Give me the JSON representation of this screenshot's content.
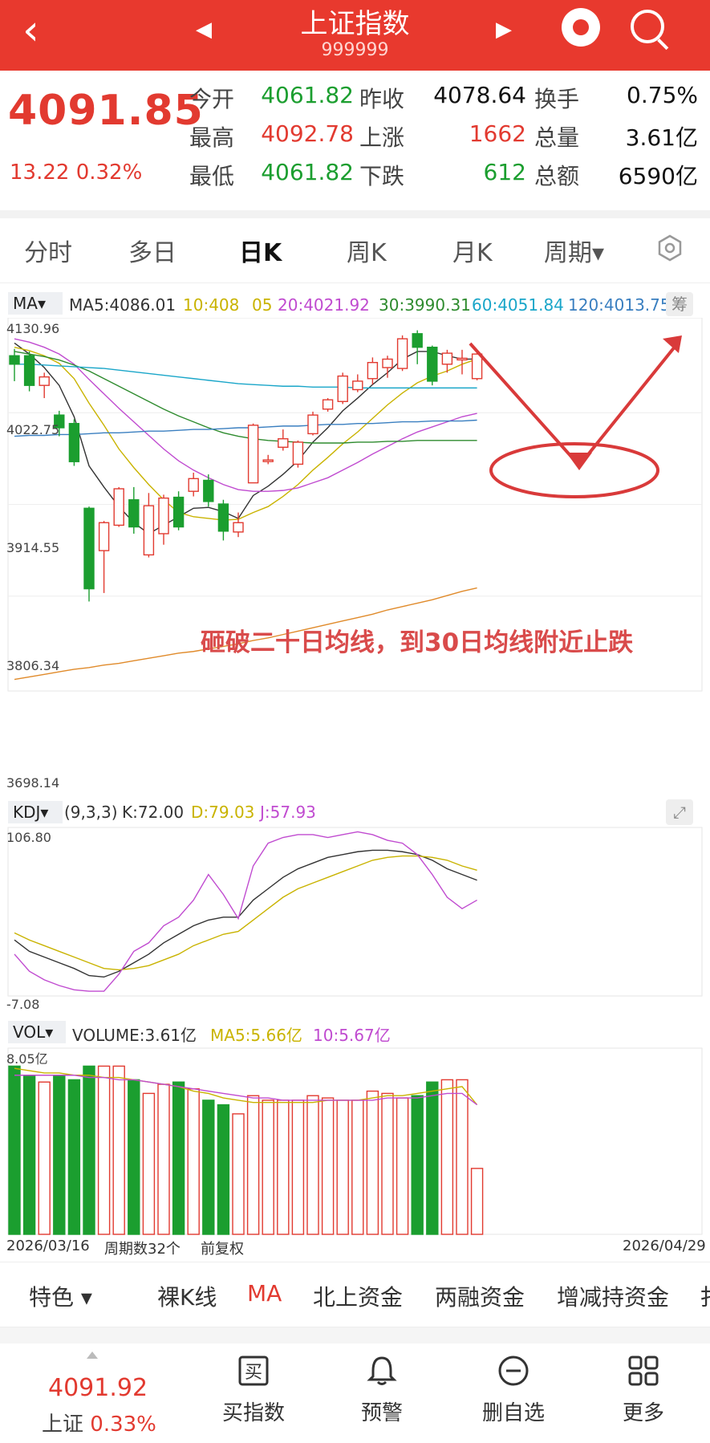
{
  "header": {
    "back_icon": "chevron-left-icon",
    "title": "上证指数",
    "code": "999999",
    "prev_icon": "triangle-left-icon",
    "next_icon": "triangle-right-icon",
    "mascot_icon": "mascot-icon",
    "search_icon": "search-icon"
  },
  "quote": {
    "price": "4091.85",
    "change": "13.22  0.32%",
    "rows": [
      [
        {
          "l": "今开"
        },
        {
          "v": "4061.82",
          "c": "g"
        },
        {
          "l": "昨收"
        },
        {
          "v": "4078.64",
          "c": "k"
        },
        {
          "l": "换手"
        },
        {
          "v": "0.75%",
          "c": "k"
        }
      ],
      [
        {
          "l": "最高"
        },
        {
          "v": "4092.78",
          "c": "r"
        },
        {
          "l": "上涨"
        },
        {
          "v": "1662",
          "c": "r"
        },
        {
          "l": "总量"
        },
        {
          "v": "3.61亿",
          "c": "k"
        }
      ],
      [
        {
          "l": "最低"
        },
        {
          "v": "4061.82",
          "c": "g"
        },
        {
          "l": "下跌"
        },
        {
          "v": "612",
          "c": "g"
        },
        {
          "l": "总额"
        },
        {
          "v": "6590亿",
          "c": "k"
        }
      ]
    ]
  },
  "tabs": [
    "分时",
    "多日",
    "日K",
    "周K",
    "月K",
    "周期▾"
  ],
  "active_tab": "日K",
  "ma": {
    "tag": "MA▾",
    "ma5": "MA5:4086.01",
    "ma10": "10:408",
    "ma_hidden": "05",
    "ma20": "20:4021.92",
    "ma30": "30:3990.31",
    "ma60": "60:4051.84",
    "ma120": "120:4013.75",
    "chou": "筹"
  },
  "price_axis": [
    "4130.96",
    "4022.75",
    "3914.55",
    "3806.34",
    "3698.14"
  ],
  "annotation": "砸破二十日均线，到30日均线附近止跌",
  "kdj": {
    "tag": "KDJ▾",
    "params": "(9,3,3)",
    "k": "K:72.00",
    "d": "D:79.03",
    "j": "J:57.93",
    "axis_top": "106.80",
    "axis_bottom": "-7.08"
  },
  "vol": {
    "tag": "VOL▾",
    "volume": "VOLUME:3.61亿",
    "ma5": "MA5:5.66亿",
    "ma10": "10:5.67亿",
    "axis_top": "8.05亿"
  },
  "dates": {
    "start": "2026/03/16",
    "count": "周期数32个",
    "fq": "前复权",
    "end": "2026/04/29"
  },
  "features": [
    "特色 ▾",
    "裸K线",
    "MA",
    "北上资金",
    "两融资金",
    "增减持资金",
    "扌"
  ],
  "bottom": {
    "price": "4091.92",
    "name": "上证",
    "pct": "0.33%",
    "buttons": [
      {
        "label": "买指数",
        "icon": "buy-icon"
      },
      {
        "label": "预警",
        "icon": "bell-icon"
      },
      {
        "label": "删自选",
        "icon": "minus-circle-icon"
      },
      {
        "label": "更多",
        "icon": "grid-icon"
      }
    ]
  },
  "colors": {
    "brand_red": "#e8392e",
    "up": "#e23a30",
    "down": "#1b9e2f",
    "ma5": "#333333",
    "ma10": "#c9b300",
    "ma20": "#c04bd0",
    "ma30": "#2e8b2e",
    "ma60": "#1aa6c9",
    "ma120": "#3a7fc0",
    "ma250": "#e08a2a"
  },
  "chart_data": {
    "type": "candlestick",
    "ylim": [
      3698.14,
      4130.96
    ],
    "candles": [
      {
        "o": 4090,
        "c": 4080,
        "h": 4098,
        "l": 4060
      },
      {
        "o": 4090,
        "c": 4055,
        "h": 4095,
        "l": 4048
      },
      {
        "o": 4055,
        "c": 4065,
        "h": 4070,
        "l": 4040
      },
      {
        "o": 4020,
        "c": 4005,
        "h": 4025,
        "l": 3995
      },
      {
        "o": 4010,
        "c": 3965,
        "h": 4015,
        "l": 3960
      },
      {
        "o": 3910,
        "c": 3815,
        "h": 3912,
        "l": 3800
      },
      {
        "o": 3860,
        "c": 3893,
        "h": 3895,
        "l": 3810
      },
      {
        "o": 3890,
        "c": 3933,
        "h": 3935,
        "l": 3888
      },
      {
        "o": 3920,
        "c": 3888,
        "h": 3935,
        "l": 3880
      },
      {
        "o": 3855,
        "c": 3913,
        "h": 3928,
        "l": 3852
      },
      {
        "o": 3880,
        "c": 3922,
        "h": 3926,
        "l": 3867
      },
      {
        "o": 3923,
        "c": 3888,
        "h": 3930,
        "l": 3884
      },
      {
        "o": 3930,
        "c": 3945,
        "h": 3952,
        "l": 3924
      },
      {
        "o": 3943,
        "c": 3918,
        "h": 3950,
        "l": 3912
      },
      {
        "o": 3915,
        "c": 3883,
        "h": 3920,
        "l": 3872
      },
      {
        "o": 3882,
        "c": 3893,
        "h": 3905,
        "l": 3876
      },
      {
        "o": 3940,
        "c": 4008,
        "h": 4010,
        "l": 3940
      },
      {
        "o": 3967,
        "c": 3967,
        "h": 3973,
        "l": 3962
      },
      {
        "o": 3982,
        "c": 3992,
        "h": 4003,
        "l": 3978
      },
      {
        "o": 3962,
        "c": 3988,
        "h": 3990,
        "l": 3958
      },
      {
        "o": 3998,
        "c": 4020,
        "h": 4024,
        "l": 3996
      },
      {
        "o": 4027,
        "c": 4038,
        "h": 4040,
        "l": 4024
      },
      {
        "o": 4036,
        "c": 4066,
        "h": 4070,
        "l": 4033
      },
      {
        "o": 4050,
        "c": 4060,
        "h": 4068,
        "l": 4047
      },
      {
        "o": 4063,
        "c": 4082,
        "h": 4088,
        "l": 4056
      },
      {
        "o": 4076,
        "c": 4086,
        "h": 4090,
        "l": 4064
      },
      {
        "o": 4075,
        "c": 4110,
        "h": 4114,
        "l": 4072
      },
      {
        "o": 4116,
        "c": 4100,
        "h": 4120,
        "l": 4080
      },
      {
        "o": 4100,
        "c": 4060,
        "h": 4102,
        "l": 4055
      },
      {
        "o": 4080,
        "c": 4093,
        "h": 4097,
        "l": 4070
      },
      {
        "o": 4086,
        "c": 4087,
        "h": 4097,
        "l": 4068
      },
      {
        "o": 4063,
        "c": 4092,
        "h": 4093,
        "l": 4061
      }
    ],
    "ma_series": [
      {
        "name": "MA5",
        "values": [
          4105,
          4092,
          4076,
          4055,
          4018,
          3960,
          3935,
          3912,
          3893,
          3880,
          3890,
          3900,
          3910,
          3911,
          3906,
          3898,
          3925,
          3936,
          3950,
          3966,
          3988,
          4005,
          4025,
          4040,
          4056,
          4070,
          4086,
          4095,
          4095,
          4090,
          4086,
          4086
        ]
      },
      {
        "name": "MA10",
        "values": [
          4100,
          4096,
          4090,
          4081,
          4063,
          4034,
          4008,
          3980,
          3958,
          3938,
          3920,
          3905,
          3900,
          3898,
          3896,
          3897,
          3905,
          3912,
          3924,
          3938,
          3955,
          3970,
          3986,
          4000,
          4016,
          4032,
          4046,
          4058,
          4066,
          4072,
          4080,
          4086
        ]
      },
      {
        "name": "MA20",
        "values": [
          4110,
          4106,
          4100,
          4092,
          4080,
          4062,
          4045,
          4028,
          4012,
          3996,
          3980,
          3966,
          3955,
          3946,
          3938,
          3932,
          3930,
          3930,
          3931,
          3934,
          3940,
          3946,
          3955,
          3964,
          3974,
          3983,
          3992,
          4000,
          4006,
          4012,
          4018,
          4022
        ]
      },
      {
        "name": "MA30",
        "values": [
          4095,
          4092,
          4089,
          4085,
          4079,
          4072,
          4063,
          4054,
          4045,
          4036,
          4027,
          4019,
          4012,
          4005,
          3999,
          3995,
          3992,
          3990,
          3989,
          3988,
          3987,
          3987,
          3987,
          3988,
          3988,
          3989,
          3989,
          3990,
          3990,
          3990,
          3990,
          3990
        ]
      },
      {
        "name": "MA60",
        "values": [
          4080,
          4080,
          4079,
          4078,
          4077,
          4076,
          4075,
          4073,
          4071,
          4069,
          4067,
          4065,
          4063,
          4061,
          4059,
          4057,
          4056,
          4055,
          4054,
          4054,
          4053,
          4053,
          4053,
          4052,
          4052,
          4052,
          4052,
          4052,
          4052,
          4052,
          4052,
          4052
        ]
      },
      {
        "name": "MA120",
        "values": [
          3995,
          3996,
          3996,
          3997,
          3997,
          3998,
          3999,
          3999,
          4000,
          4001,
          4001,
          4002,
          4003,
          4003,
          4004,
          4005,
          4005,
          4006,
          4007,
          4007,
          4008,
          4009,
          4009,
          4010,
          4010,
          4011,
          4012,
          4012,
          4013,
          4013,
          4013,
          4014
        ]
      },
      {
        "name": "MA250",
        "values": [
          3708,
          3711,
          3714,
          3717,
          3720,
          3722,
          3725,
          3727,
          3730,
          3733,
          3736,
          3739,
          3741,
          3744,
          3747,
          3750,
          3754,
          3757,
          3761,
          3765,
          3769,
          3773,
          3777,
          3781,
          3785,
          3790,
          3794,
          3798,
          3802,
          3807,
          3812,
          3816
        ]
      }
    ],
    "kdj": {
      "ylim": [
        -7.08,
        106.8
      ],
      "K": [
        30,
        22,
        18,
        14,
        10,
        5,
        4,
        8,
        14,
        20,
        28,
        34,
        40,
        44,
        46,
        46,
        58,
        66,
        74,
        80,
        84,
        88,
        90,
        92,
        93,
        93,
        92,
        90,
        86,
        80,
        76,
        72
      ],
      "D": [
        35,
        30,
        26,
        22,
        18,
        14,
        10,
        9,
        10,
        12,
        16,
        20,
        26,
        30,
        34,
        36,
        44,
        52,
        60,
        66,
        70,
        74,
        78,
        82,
        86,
        88,
        89,
        89,
        88,
        86,
        82,
        79
      ],
      "J": [
        20,
        8,
        2,
        -2,
        -5,
        -6,
        -6,
        6,
        22,
        28,
        40,
        46,
        58,
        76,
        62,
        45,
        82,
        98,
        102,
        104,
        104,
        102,
        104,
        106,
        104,
        100,
        98,
        90,
        76,
        60,
        52,
        58
      ]
    },
    "volume": {
      "ylim": [
        0,
        8.05
      ],
      "values": [
        7.4,
        7.0,
        6.7,
        7.0,
        6.8,
        7.4,
        7.4,
        7.4,
        6.8,
        6.2,
        6.6,
        6.7,
        6.4,
        5.9,
        5.7,
        5.3,
        6.1,
        5.9,
        5.9,
        5.9,
        6.1,
        6.0,
        5.9,
        5.9,
        6.3,
        6.2,
        6.0,
        6.1,
        6.7,
        6.8,
        6.8,
        2.9
      ],
      "ma5": [
        7.3,
        7.2,
        7.1,
        7.1,
        7.0,
        7.0,
        6.9,
        6.9,
        6.8,
        6.7,
        6.6,
        6.5,
        6.3,
        6.2,
        6.0,
        5.9,
        5.8,
        5.8,
        5.8,
        5.8,
        5.8,
        5.9,
        5.9,
        5.9,
        6.0,
        6.1,
        6.1,
        6.2,
        6.3,
        6.4,
        6.5,
        5.7
      ],
      "ma10": [
        7.0,
        7.0,
        7.0,
        7.0,
        7.0,
        6.9,
        6.9,
        6.8,
        6.8,
        6.7,
        6.6,
        6.5,
        6.4,
        6.3,
        6.2,
        6.1,
        6.0,
        6.0,
        5.9,
        5.9,
        5.9,
        5.9,
        5.9,
        5.9,
        5.9,
        6.0,
        6.0,
        6.0,
        6.1,
        6.2,
        6.2,
        5.7
      ]
    }
  }
}
